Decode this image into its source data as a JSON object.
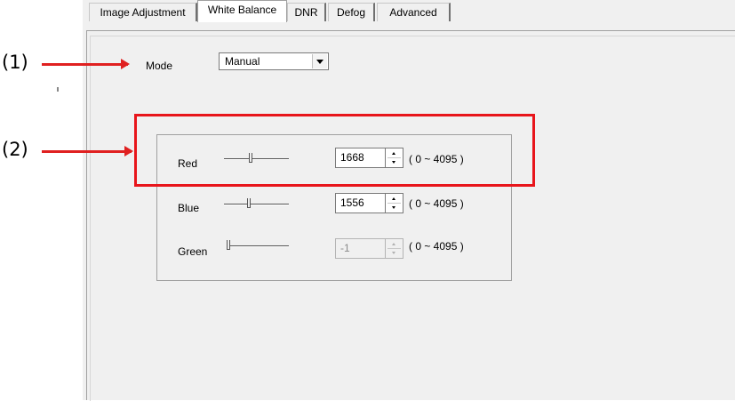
{
  "tabs": [
    {
      "label": "Image Adjustment",
      "active": false
    },
    {
      "label": "White Balance",
      "active": true
    },
    {
      "label": "DNR",
      "active": false
    },
    {
      "label": "Defog",
      "active": false
    },
    {
      "label": "Advanced",
      "active": false
    }
  ],
  "mode": {
    "label": "Mode",
    "value": "Manual"
  },
  "channels": [
    {
      "label": "Red",
      "value": "1668",
      "range": "( 0 ~ 4095 )",
      "slider_fraction": 0.41,
      "enabled": true
    },
    {
      "label": "Blue",
      "value": "1556",
      "range": "( 0 ~ 4095 )",
      "slider_fraction": 0.38,
      "enabled": true
    },
    {
      "label": "Green",
      "value": "-1",
      "range": "( 0 ~ 4095 )",
      "slider_fraction": 0.0,
      "enabled": false
    }
  ],
  "annotations": {
    "callout1": "(1)",
    "callout2": "(2)",
    "color": "#e02020"
  }
}
